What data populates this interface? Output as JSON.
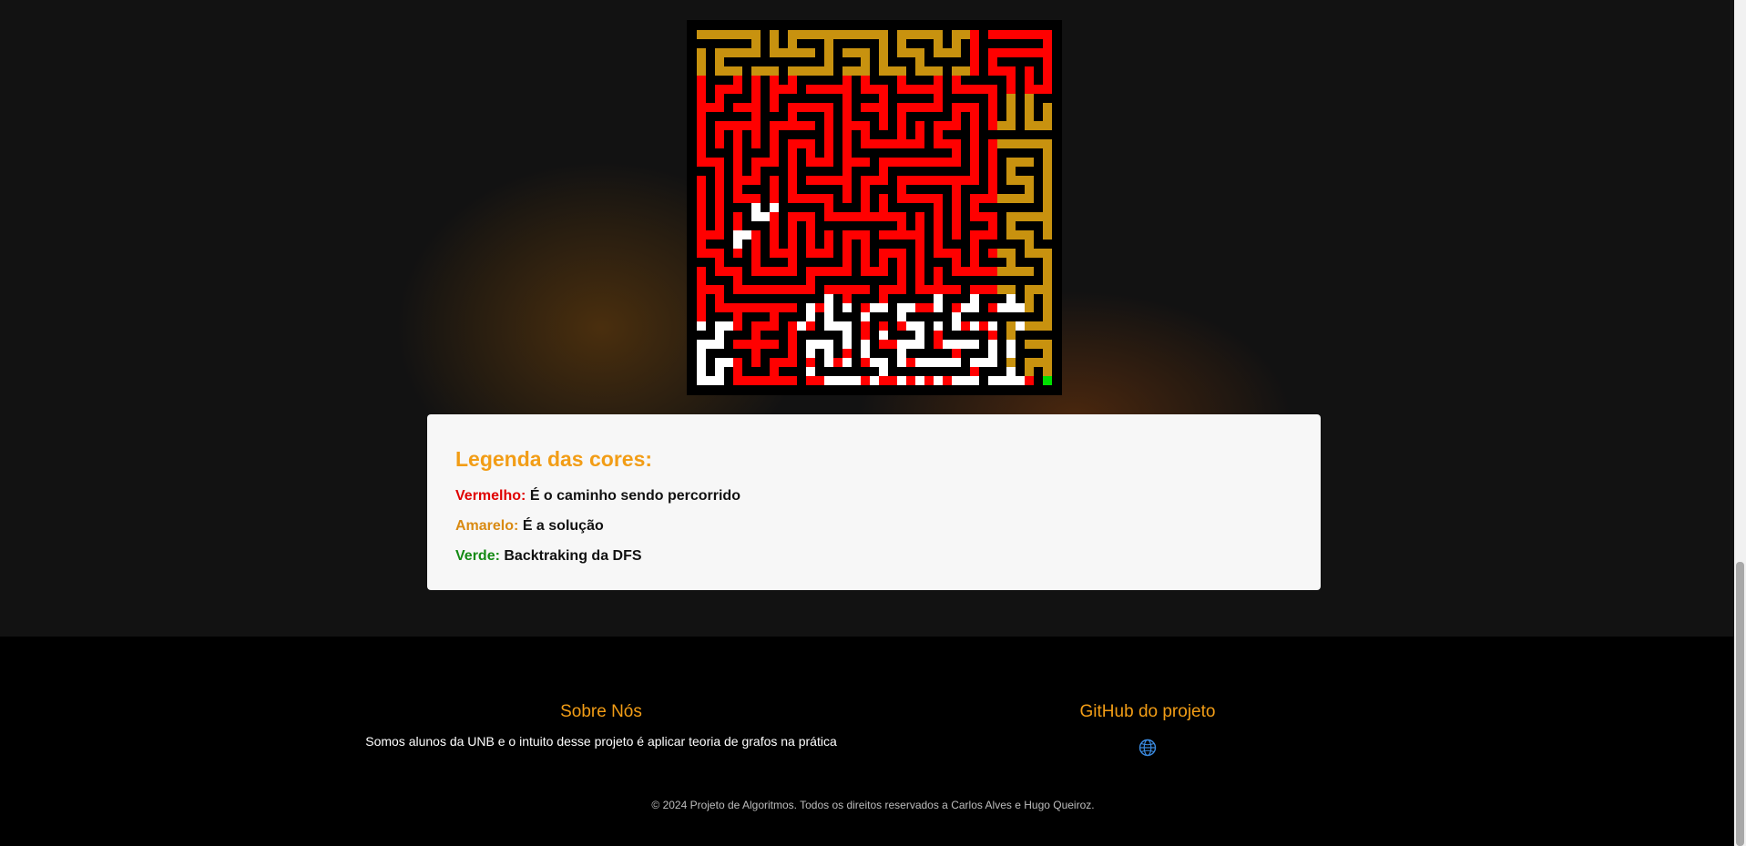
{
  "maze": {
    "colors": {
      "background": "#000000",
      "visited": "#ff0000",
      "solution": "#c8920f",
      "unvisited": "#ffffff",
      "goal": "#00e000"
    },
    "legend_colors": [
      "visited",
      "solution",
      "dfs-backtrack",
      "goal"
    ]
  },
  "legend": {
    "title": "Legenda das cores:",
    "items": [
      {
        "label": "Vermelho:",
        "text": "É o caminho sendo percorrido",
        "color": "#e00000"
      },
      {
        "label": "Amarelo:",
        "text": "É a solução",
        "color": "#d98a12"
      },
      {
        "label": "Verde:",
        "text": "Backtraking da DFS",
        "color": "#148a14"
      }
    ]
  },
  "footer": {
    "about_title": "Sobre Nós",
    "about_text": "Somos alunos da UNB e o intuito desse projeto é aplicar teoria de grafos na prática",
    "github_title": "GitHub do projeto",
    "github_icon": "globe-icon",
    "copyright": "© 2024 Projeto de Algoritmos. Todos os direitos reservados a Carlos Alves e Hugo Queiroz."
  }
}
